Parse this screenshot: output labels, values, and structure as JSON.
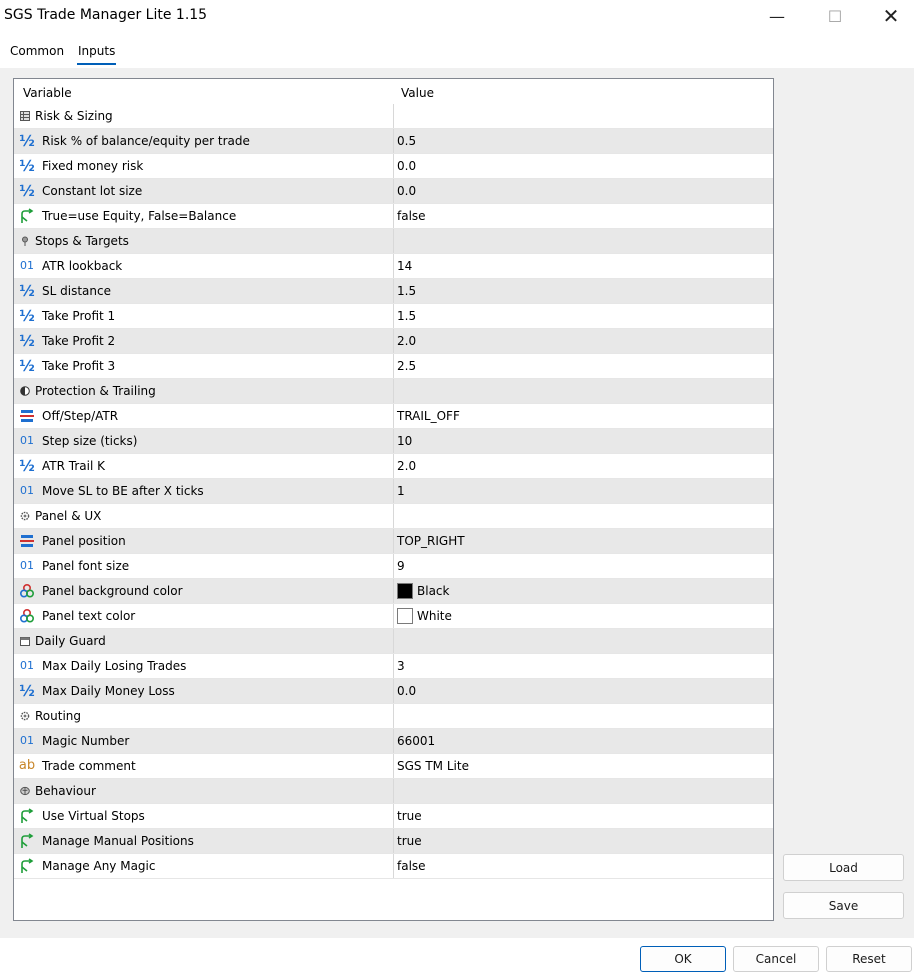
{
  "window": {
    "title": "SGS Trade Manager Lite 1.15",
    "minimize_glyph": "—",
    "maximize_glyph": "☐",
    "close_glyph": "✕"
  },
  "tabs": [
    {
      "label": "Common",
      "active": false
    },
    {
      "label": "Inputs",
      "active": true
    }
  ],
  "grid": {
    "col_variable": "Variable",
    "col_value": "Value",
    "rows": [
      {
        "type": "group",
        "icon": "grid-icon",
        "name": "Risk & Sizing",
        "value": ""
      },
      {
        "type": "input",
        "icon": "half-icon",
        "name": "Risk % of balance/equity per trade",
        "value": "0.5"
      },
      {
        "type": "input",
        "icon": "half-icon",
        "name": "Fixed money risk",
        "value": "0.0"
      },
      {
        "type": "input",
        "icon": "half-icon",
        "name": "Constant lot size",
        "value": "0.0"
      },
      {
        "type": "input",
        "icon": "bool-icon",
        "name": "True=use Equity, False=Balance",
        "value": "false"
      },
      {
        "type": "group",
        "icon": "pin-icon",
        "name": "Stops & Targets",
        "value": ""
      },
      {
        "type": "input",
        "icon": "int-icon",
        "name": "ATR lookback",
        "value": "14"
      },
      {
        "type": "input",
        "icon": "half-icon",
        "name": "SL distance",
        "value": "1.5"
      },
      {
        "type": "input",
        "icon": "half-icon",
        "name": "Take Profit 1",
        "value": "1.5"
      },
      {
        "type": "input",
        "icon": "half-icon",
        "name": "Take Profit 2",
        "value": "2.0"
      },
      {
        "type": "input",
        "icon": "half-icon",
        "name": "Take Profit 3",
        "value": "2.5"
      },
      {
        "type": "group",
        "icon": "shield-icon",
        "name": "Protection & Trailing",
        "value": ""
      },
      {
        "type": "input",
        "icon": "enum-icon",
        "name": "Off/Step/ATR",
        "value": "TRAIL_OFF"
      },
      {
        "type": "input",
        "icon": "int-icon",
        "name": "Step size (ticks)",
        "value": "10"
      },
      {
        "type": "input",
        "icon": "half-icon",
        "name": "ATR Trail K",
        "value": "2.0"
      },
      {
        "type": "input",
        "icon": "int-icon",
        "name": "Move SL to BE after X ticks",
        "value": "1"
      },
      {
        "type": "group",
        "icon": "gear-icon",
        "name": "Panel & UX",
        "value": ""
      },
      {
        "type": "input",
        "icon": "enum-icon",
        "name": "Panel position",
        "value": "TOP_RIGHT"
      },
      {
        "type": "input",
        "icon": "int-icon",
        "name": "Panel font size",
        "value": "9"
      },
      {
        "type": "input",
        "icon": "color-icon",
        "name": "Panel background color",
        "value": "Black",
        "swatch": "#000000"
      },
      {
        "type": "input",
        "icon": "color-icon",
        "name": "Panel text color",
        "value": "White",
        "swatch": "#ffffff"
      },
      {
        "type": "group",
        "icon": "calendar-icon",
        "name": "Daily Guard",
        "value": ""
      },
      {
        "type": "input",
        "icon": "int-icon",
        "name": "Max Daily Losing Trades",
        "value": "3"
      },
      {
        "type": "input",
        "icon": "half-icon",
        "name": "Max Daily Money Loss",
        "value": "0.0"
      },
      {
        "type": "group",
        "icon": "cog-icon",
        "name": "Routing",
        "value": ""
      },
      {
        "type": "input",
        "icon": "int-icon",
        "name": "Magic Number",
        "value": "66001"
      },
      {
        "type": "input",
        "icon": "string-icon",
        "name": "Trade comment",
        "value": "SGS TM Lite"
      },
      {
        "type": "group",
        "icon": "brain-icon",
        "name": "Behaviour",
        "value": ""
      },
      {
        "type": "input",
        "icon": "bool-icon",
        "name": "Use Virtual Stops",
        "value": "true"
      },
      {
        "type": "input",
        "icon": "bool-icon",
        "name": "Manage Manual Positions",
        "value": "true"
      },
      {
        "type": "input",
        "icon": "bool-icon",
        "name": "Manage Any Magic",
        "value": "false"
      }
    ]
  },
  "side_buttons": {
    "load": "Load",
    "save": "Save"
  },
  "footer_buttons": {
    "ok": "OK",
    "cancel": "Cancel",
    "reset": "Reset"
  },
  "colors": {
    "accent": "#005fb8",
    "icon_blue": "#1e6fd0",
    "icon_green": "#1f9e3a",
    "icon_orange": "#c8862a",
    "row_alt": "#e8e8e8"
  },
  "icon_glyphs": {
    "half-icon": "½",
    "int-icon": "01",
    "string-icon": "ab"
  }
}
